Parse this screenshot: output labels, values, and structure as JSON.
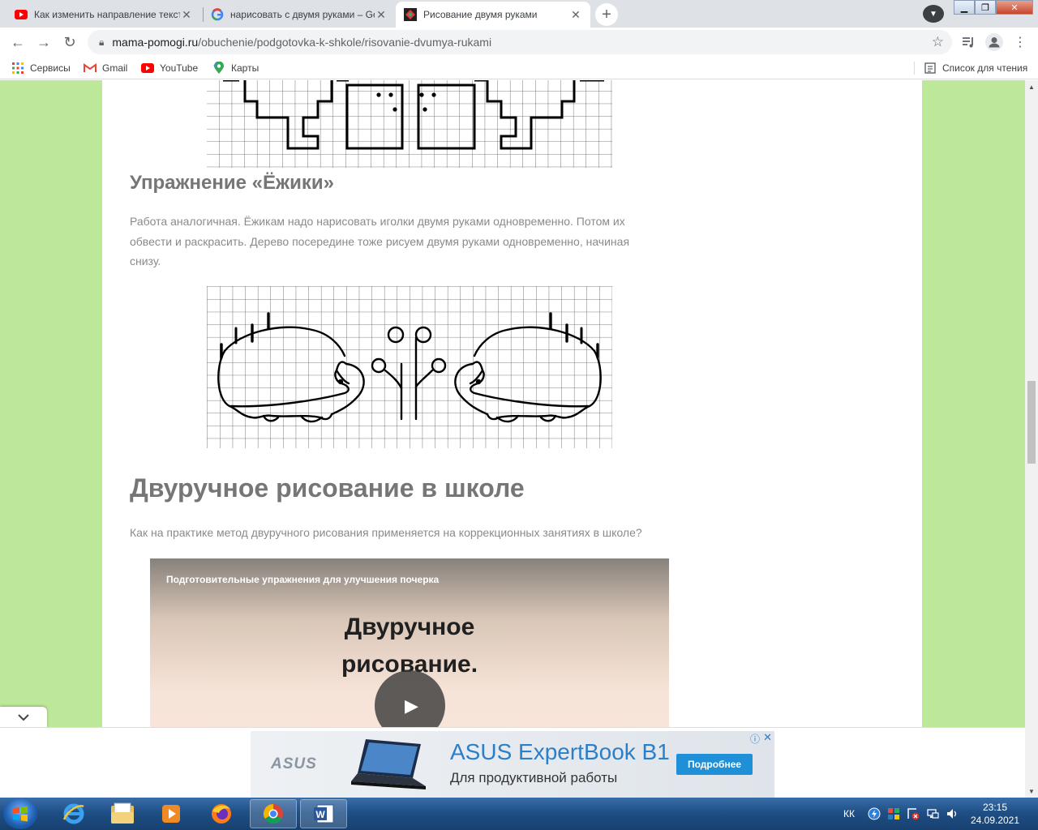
{
  "tabs": [
    {
      "title": "Как изменить направление текста",
      "icon": "youtube-icon"
    },
    {
      "title": "нарисовать с двумя руками – Google",
      "icon": "google-icon"
    },
    {
      "title": "Рисование двумя руками",
      "icon": "site-icon",
      "active": true
    }
  ],
  "toolbar": {
    "url_host": "mama-pomogi.ru",
    "url_path": "/obuchenie/podgotovka-k-shkole/risovanie-dvumya-rukami"
  },
  "bookmarks": {
    "services": "Сервисы",
    "gmail": "Gmail",
    "youtube": "YouTube",
    "maps": "Карты",
    "reading_list": "Список для чтения"
  },
  "article": {
    "hedgehog_heading": "Упражнение «Ёжики»",
    "hedgehog_p1": "Работа аналогичная. Ёжикам надо нарисовать иголки двумя руками одновременно. Потом их",
    "hedgehog_p2": "обвести и раскрасить. Дерево посередине тоже рисуем двумя руками одновременно, начиная",
    "hedgehog_p3": "снизу.",
    "school_heading": "Двуручное рисование в школе",
    "school_text": "Как на практике метод двуручного рисования применяется на коррекционных занятиях в школе?"
  },
  "video": {
    "title": "Подготовительные упражнения для улучшения почерка",
    "line1": "Двуручное",
    "line2": "рисование."
  },
  "ad": {
    "brand": "ASUS",
    "headline": "ASUS ExpertBook B1",
    "subline": "Для продуктивной работы",
    "cta": "Подробнее",
    "brand_color": "#1f8fd8"
  },
  "taskbar": {
    "lang": "КК",
    "time": "23:15",
    "date": "24.09.2021"
  }
}
